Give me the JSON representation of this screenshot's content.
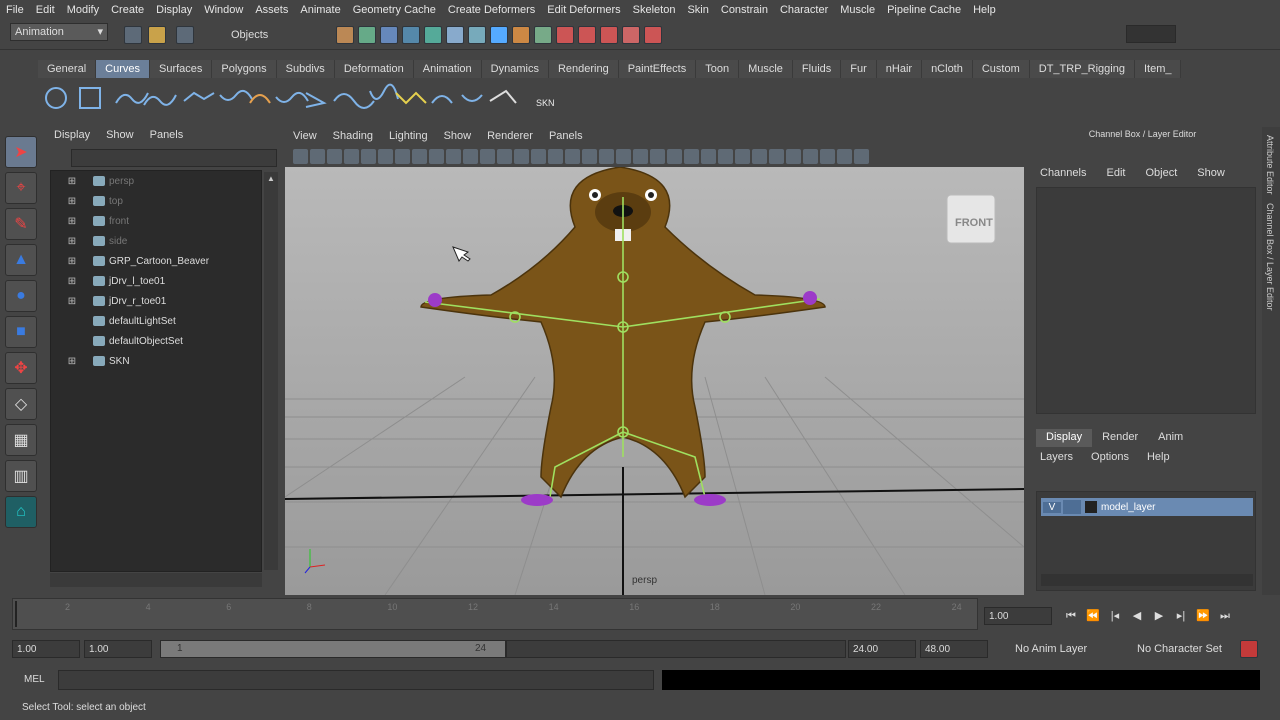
{
  "menu": [
    "File",
    "Edit",
    "Modify",
    "Create",
    "Display",
    "Window",
    "Assets",
    "Animate",
    "Geometry Cache",
    "Create Deformers",
    "Edit Deformers",
    "Skeleton",
    "Skin",
    "Constrain",
    "Character",
    "Muscle",
    "Pipeline Cache",
    "Help"
  ],
  "status": {
    "mode_select": "Animation",
    "objects_label": "Objects"
  },
  "shelf_tabs": [
    "General",
    "Curves",
    "Surfaces",
    "Polygons",
    "Subdivs",
    "Deformation",
    "Animation",
    "Dynamics",
    "Rendering",
    "PaintEffects",
    "Toon",
    "Muscle",
    "Fluids",
    "Fur",
    "nHair",
    "nCloth",
    "Custom",
    "DT_TRP_Rigging",
    "Item_"
  ],
  "shelf_active": "Curves",
  "shelf_skn_label": "SKN",
  "outliner": {
    "menu": [
      "Display",
      "Show",
      "Panels"
    ],
    "items": [
      {
        "label": "persp",
        "dim": true,
        "expand": true
      },
      {
        "label": "top",
        "dim": true,
        "expand": true
      },
      {
        "label": "front",
        "dim": true,
        "expand": true
      },
      {
        "label": "side",
        "dim": true,
        "expand": true
      },
      {
        "label": "GRP_Cartoon_Beaver",
        "dim": false,
        "expand": true
      },
      {
        "label": "jDrv_l_toe01",
        "dim": false,
        "expand": true
      },
      {
        "label": "jDrv_r_toe01",
        "dim": false,
        "expand": true
      },
      {
        "label": "defaultLightSet",
        "dim": false,
        "expand": false
      },
      {
        "label": "defaultObjectSet",
        "dim": false,
        "expand": false
      },
      {
        "label": "SKN",
        "dim": false,
        "expand": true
      }
    ]
  },
  "viewport": {
    "menu": [
      "View",
      "Shading",
      "Lighting",
      "Show",
      "Renderer",
      "Panels"
    ],
    "camera_label": "persp",
    "viewcube_label": "FRONT"
  },
  "channel": {
    "title": "Channel Box / Layer Editor",
    "menu": [
      "Channels",
      "Edit",
      "Object",
      "Show"
    ],
    "tabs": [
      "Display",
      "Render",
      "Anim"
    ],
    "active_tab": "Display",
    "layer_menu": [
      "Layers",
      "Options",
      "Help"
    ],
    "layer_visibility": "V",
    "layer_name": "model_layer",
    "side_tabs": [
      "Attribute Editor",
      "Channel Box / Layer Editor"
    ]
  },
  "timeline": {
    "ticks": [
      "2",
      "4",
      "6",
      "8",
      "10",
      "12",
      "14",
      "16",
      "18",
      "20",
      "22",
      "24"
    ],
    "current_frame": "1.00"
  },
  "range": {
    "start": "1.00",
    "playback_start": "1.00",
    "slider_start": "1",
    "slider_end": "24",
    "playback_end": "24.00",
    "end": "48.00",
    "anim_layer": "No Anim Layer",
    "char_set": "No Character Set"
  },
  "cmd_label": "MEL",
  "help_line": "Select Tool: select an object"
}
